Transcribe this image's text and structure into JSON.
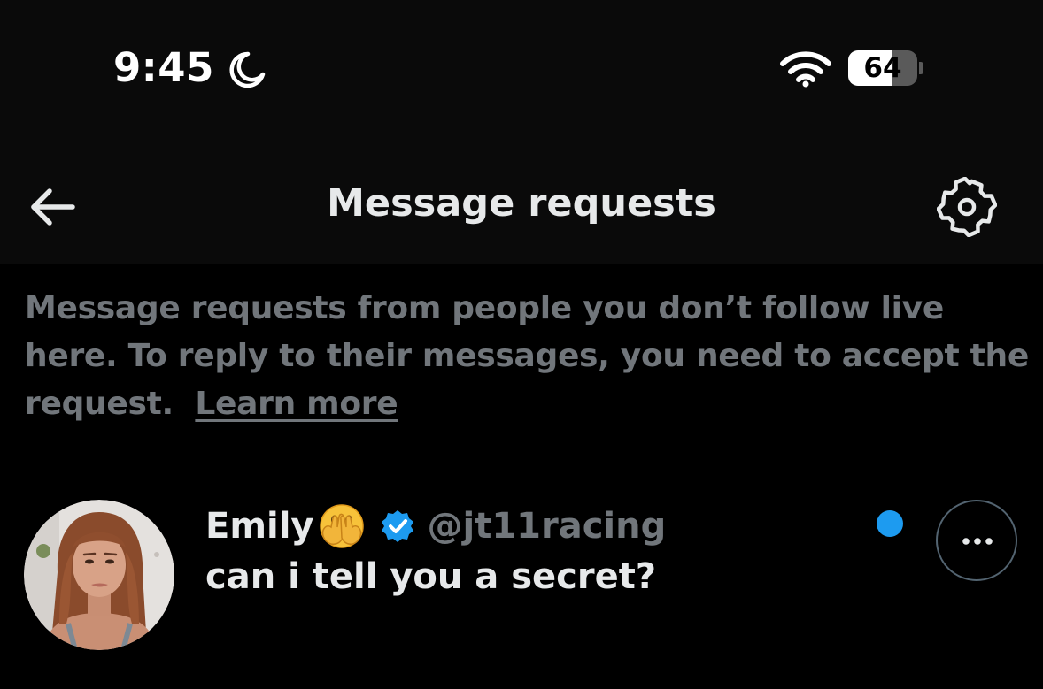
{
  "status_bar": {
    "time": "9:45",
    "battery_percent": "64",
    "battery_level": 0.64,
    "icons": [
      "moon-icon",
      "wifi-icon",
      "battery-icon"
    ]
  },
  "header": {
    "title": "Message requests",
    "back_icon": "arrow-left-icon",
    "settings_icon": "gear-icon"
  },
  "info": {
    "text": "Message requests from people you don’t follow live here. To reply to their messages, you need to accept the request.",
    "link_label": "Learn more"
  },
  "requests": [
    {
      "name": "Emily",
      "emoji": "face-with-open-eyes-and-hand-over-mouth",
      "verified": true,
      "handle": "@jt11racing",
      "message": "can i tell you a secret?",
      "unread": true
    }
  ],
  "colors": {
    "background": "#000000",
    "header_background": "#0a0a0a",
    "primary_text": "#e7e9ea",
    "secondary_text": "#71767b",
    "accent_blue": "#1d9bf0"
  }
}
